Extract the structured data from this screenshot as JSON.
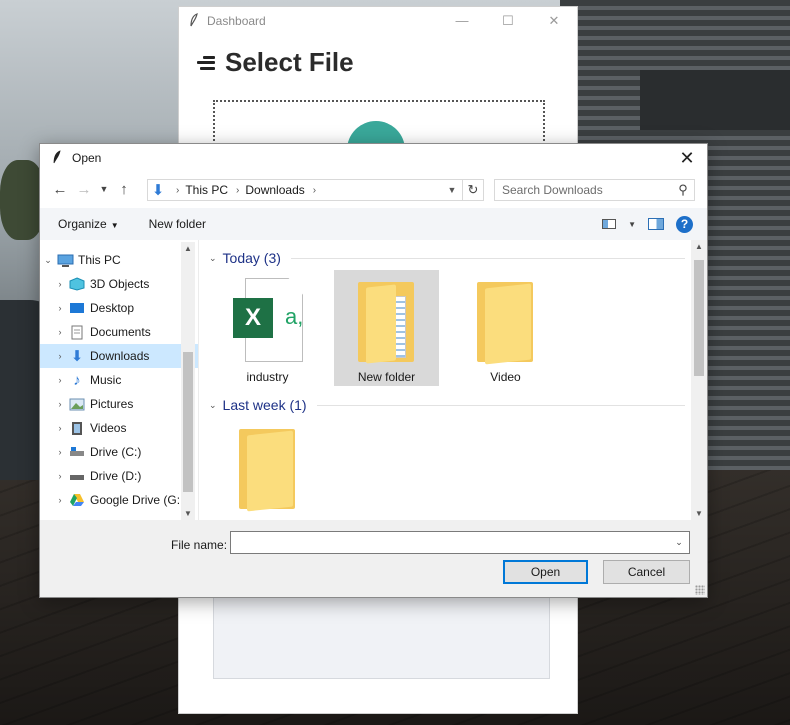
{
  "dashboard": {
    "title": "Dashboard",
    "heading": "Select File",
    "controls": [
      "—",
      "☐",
      "✕"
    ]
  },
  "dialog": {
    "title": "Open",
    "close": "✕",
    "address": {
      "crumbs": [
        "This PC",
        "Downloads"
      ]
    },
    "search": {
      "placeholder": "Search Downloads"
    },
    "toolbar": {
      "organize": "Organize",
      "new_folder": "New folder",
      "help": "?"
    },
    "nav_items": [
      {
        "label": "This PC",
        "icon": "computer-icon",
        "expanded": true,
        "level": 0
      },
      {
        "label": "3D Objects",
        "icon": "3d-objects-icon",
        "level": 1
      },
      {
        "label": "Desktop",
        "icon": "desktop-icon",
        "level": 1
      },
      {
        "label": "Documents",
        "icon": "documents-icon",
        "level": 1
      },
      {
        "label": "Downloads",
        "icon": "downloads-icon",
        "level": 1,
        "selected": true
      },
      {
        "label": "Music",
        "icon": "music-icon",
        "level": 1
      },
      {
        "label": "Pictures",
        "icon": "pictures-icon",
        "level": 1
      },
      {
        "label": "Videos",
        "icon": "videos-icon",
        "level": 1
      },
      {
        "label": "Drive (C:)",
        "icon": "drive-c-icon",
        "level": 1
      },
      {
        "label": "Drive (D:)",
        "icon": "drive-d-icon",
        "level": 1
      },
      {
        "label": "Google Drive (G:",
        "icon": "google-drive-icon",
        "level": 1
      }
    ],
    "groups": [
      {
        "label": "Today (3)"
      },
      {
        "label": "Last week (1)"
      }
    ],
    "files": [
      {
        "name": "industry",
        "type": "excel-file",
        "group": 0
      },
      {
        "name": "New folder",
        "type": "folder",
        "group": 0,
        "selected": true
      },
      {
        "name": "Video",
        "type": "folder",
        "group": 0
      },
      {
        "name": "",
        "type": "folder",
        "group": 1
      }
    ],
    "file_name": {
      "label": "File name:",
      "value": ""
    },
    "buttons": {
      "open": "Open",
      "cancel": "Cancel"
    }
  },
  "colors": {
    "accent": "#0078d7",
    "selection": "#cce8ff",
    "group_header": "#1e3287",
    "excel_green": "#1e7145",
    "folder_yellow": "#f4c95d"
  }
}
